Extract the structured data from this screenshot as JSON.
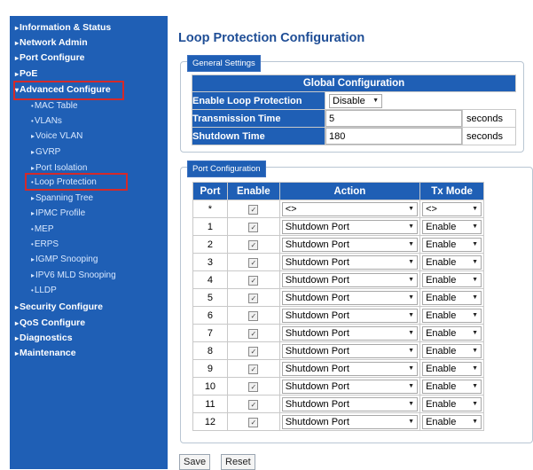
{
  "sidebar": {
    "items": [
      {
        "label": "Information & Status",
        "caret": "▸"
      },
      {
        "label": "Network Admin",
        "caret": "▸"
      },
      {
        "label": "Port Configure",
        "caret": "▸"
      },
      {
        "label": "PoE",
        "caret": "▸"
      },
      {
        "label": "Advanced Configure",
        "caret": "▾"
      },
      {
        "label": "MAC Table",
        "caret": "•"
      },
      {
        "label": "VLANs",
        "caret": "•"
      },
      {
        "label": "Voice VLAN",
        "caret": "▸"
      },
      {
        "label": "GVRP",
        "caret": "▸"
      },
      {
        "label": "Port Isolation",
        "caret": "▸"
      },
      {
        "label": "Loop Protection",
        "caret": "•"
      },
      {
        "label": "Spanning Tree",
        "caret": "▸"
      },
      {
        "label": "IPMC Profile",
        "caret": "▸"
      },
      {
        "label": "MEP",
        "caret": "•"
      },
      {
        "label": "ERPS",
        "caret": "•"
      },
      {
        "label": "IGMP Snooping",
        "caret": "▸"
      },
      {
        "label": "IPV6 MLD Snooping",
        "caret": "▸"
      },
      {
        "label": "LLDP",
        "caret": "•"
      },
      {
        "label": "Security Configure",
        "caret": "▸"
      },
      {
        "label": "QoS Configure",
        "caret": "▸"
      },
      {
        "label": "Diagnostics",
        "caret": "▸"
      },
      {
        "label": "Maintenance",
        "caret": "▸"
      }
    ]
  },
  "page": {
    "title": "Loop Protection Configuration"
  },
  "general": {
    "legend": "General Settings",
    "header": "Global Configuration",
    "enable_label": "Enable Loop Protection",
    "enable_value": "Disable",
    "tx_label": "Transmission Time",
    "tx_value": "5",
    "tx_unit": "seconds",
    "shutdown_label": "Shutdown Time",
    "shutdown_value": "180",
    "shutdown_unit": "seconds"
  },
  "port_config": {
    "legend": "Port Configuration",
    "columns": {
      "port": "Port",
      "enable": "Enable",
      "action": "Action",
      "tx_mode": "Tx Mode"
    },
    "rows": [
      {
        "port": "*",
        "enable": true,
        "action": "<>",
        "tx_mode": "<>"
      },
      {
        "port": "1",
        "enable": true,
        "action": "Shutdown Port",
        "tx_mode": "Enable"
      },
      {
        "port": "2",
        "enable": true,
        "action": "Shutdown Port",
        "tx_mode": "Enable"
      },
      {
        "port": "3",
        "enable": true,
        "action": "Shutdown Port",
        "tx_mode": "Enable"
      },
      {
        "port": "4",
        "enable": true,
        "action": "Shutdown Port",
        "tx_mode": "Enable"
      },
      {
        "port": "5",
        "enable": true,
        "action": "Shutdown Port",
        "tx_mode": "Enable"
      },
      {
        "port": "6",
        "enable": true,
        "action": "Shutdown Port",
        "tx_mode": "Enable"
      },
      {
        "port": "7",
        "enable": true,
        "action": "Shutdown Port",
        "tx_mode": "Enable"
      },
      {
        "port": "8",
        "enable": true,
        "action": "Shutdown Port",
        "tx_mode": "Enable"
      },
      {
        "port": "9",
        "enable": true,
        "action": "Shutdown Port",
        "tx_mode": "Enable"
      },
      {
        "port": "10",
        "enable": true,
        "action": "Shutdown Port",
        "tx_mode": "Enable"
      },
      {
        "port": "11",
        "enable": true,
        "action": "Shutdown Port",
        "tx_mode": "Enable"
      },
      {
        "port": "12",
        "enable": true,
        "action": "Shutdown Port",
        "tx_mode": "Enable"
      }
    ]
  },
  "buttons": {
    "save": "Save",
    "reset": "Reset"
  }
}
